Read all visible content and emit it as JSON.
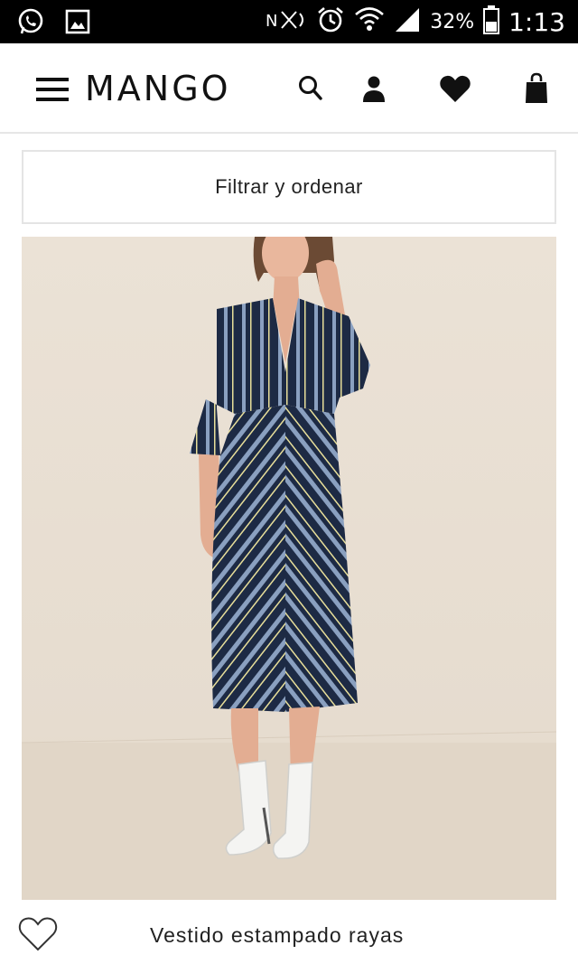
{
  "status_bar": {
    "battery": "32%",
    "time": "1:13",
    "left_icons": [
      "whatsapp-icon",
      "gallery-icon"
    ],
    "right_icons": [
      "nfc-icon",
      "alarm-icon",
      "wifi-icon",
      "signal-icon",
      "battery-icon"
    ]
  },
  "header": {
    "logo": "MANGO",
    "icons": [
      "menu-icon",
      "search-icon",
      "account-icon",
      "wishlist-icon",
      "bag-icon"
    ]
  },
  "filter": {
    "label": "Filtrar y ordenar"
  },
  "product": {
    "name": "Vestido estampado rayas",
    "image_colors": {
      "background": "#e8ddd0",
      "dress": "#1d2a44",
      "stripe_blue": "#8aa0c0",
      "stripe_yellow": "#e8df9a",
      "boots": "#f4f4f2"
    }
  }
}
